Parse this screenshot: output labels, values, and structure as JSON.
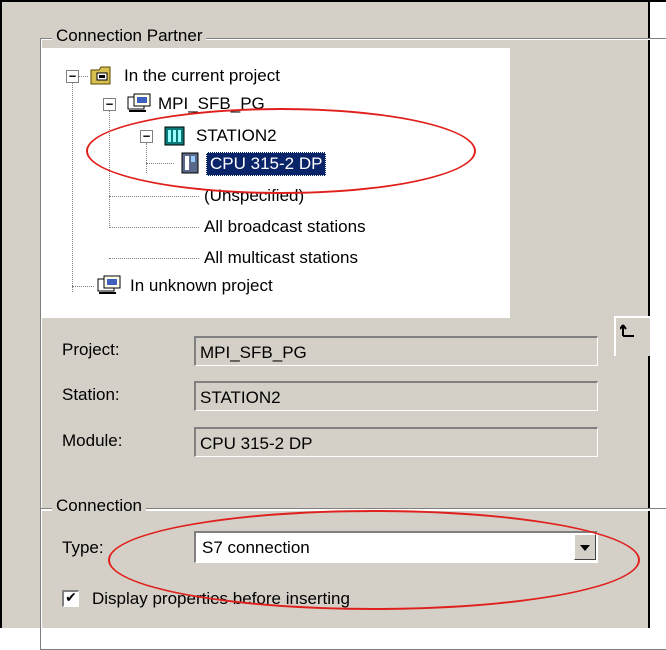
{
  "connection_partner": {
    "group_title": "Connection Partner",
    "tree": [
      {
        "label": "In the current project",
        "icon": "folder-project-icon"
      },
      {
        "label": "MPI_SFB_PG",
        "icon": "project-icon"
      },
      {
        "label": "STATION2",
        "icon": "station-icon"
      },
      {
        "label": "CPU 315-2 DP",
        "icon": "cpu-module-icon",
        "selected": true
      },
      {
        "label": "(Unspecified)"
      },
      {
        "label": "All broadcast stations"
      },
      {
        "label": "All multicast stations"
      },
      {
        "label": "In unknown project",
        "icon": "project-icon"
      }
    ],
    "fields": {
      "project_label": "Project:",
      "project_value": "MPI_SFB_PG",
      "station_label": "Station:",
      "station_value": "STATION2",
      "module_label": "Module:",
      "module_value": "CPU 315-2 DP"
    }
  },
  "connection": {
    "group_title": "Connection",
    "type_label": "Type:",
    "type_value": "S7 connection",
    "display_properties_label": "Display properties before inserting",
    "display_properties_checked": true,
    "check_mark": "✔"
  },
  "colors": {
    "dialog_bg": "#d4d0c8",
    "selection": "#0a246a",
    "annotation_red": "#e0201c"
  }
}
